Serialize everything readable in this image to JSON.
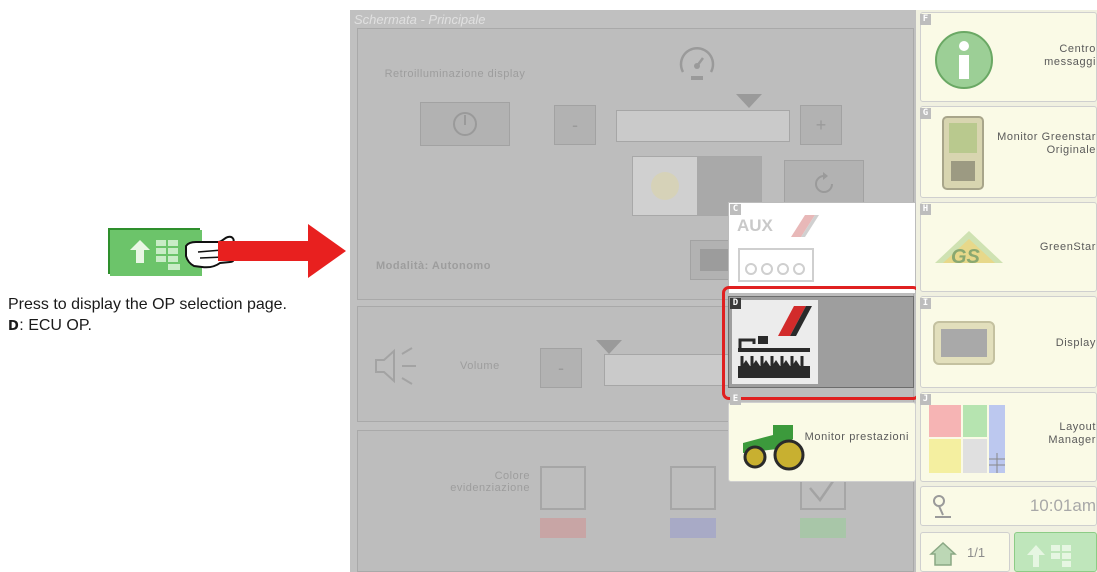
{
  "note": {
    "text": "Press to display the OP selection page.",
    "letter": "D",
    "desc": ": ECU OP."
  },
  "screen": {
    "title": "Schermata - Principale",
    "backlight_label": "Retroilluminazione display",
    "mode_label": "Modalità: Autonomo",
    "volume_label": "Volume",
    "highlight_label": "Colore evidenziazione",
    "minus": "-",
    "plus": "+"
  },
  "popup": {
    "c": {
      "letter": "C",
      "aux": "AUX"
    },
    "d": {
      "letter": "D"
    },
    "e": {
      "letter": "E",
      "label": "Monitor prestazioni"
    }
  },
  "right_column": {
    "f": {
      "letter": "F",
      "label": "Centro messaggi"
    },
    "g": {
      "letter": "G",
      "label": "Monitor Greenstar Originale"
    },
    "h": {
      "letter": "H",
      "label": "GreenStar",
      "logo": "GS"
    },
    "i": {
      "letter": "I",
      "label": "Display"
    },
    "j": {
      "letter": "J",
      "label": "Layout Manager"
    },
    "time": "10:01am",
    "page": "1/1"
  },
  "colors": {
    "accent_red": "#e02020",
    "arrow_red": "#e8201f",
    "button_green": "#5fbf5c",
    "tile_bg": "#fafae6"
  }
}
